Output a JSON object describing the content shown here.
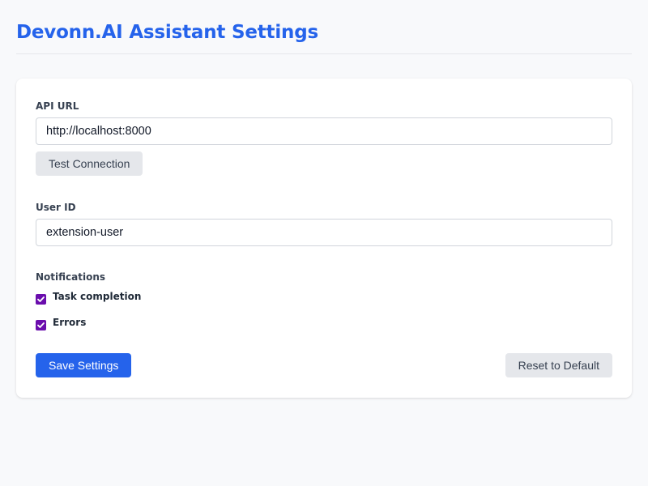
{
  "header": {
    "title": "Devonn.AI Assistant Settings"
  },
  "api_url": {
    "label": "API URL",
    "value": "http://localhost:8000",
    "test_button_label": "Test Connection"
  },
  "user_id": {
    "label": "User ID",
    "value": "extension-user"
  },
  "notifications": {
    "label": "Notifications",
    "items": [
      {
        "label": "Task completion",
        "checked": true
      },
      {
        "label": "Errors",
        "checked": true
      }
    ]
  },
  "actions": {
    "save_label": "Save Settings",
    "reset_label": "Reset to Default"
  },
  "colors": {
    "accent": "#2563eb",
    "checkbox": "#6a0dad",
    "background": "#f8f9fb",
    "secondary_button": "#e5e7eb"
  }
}
